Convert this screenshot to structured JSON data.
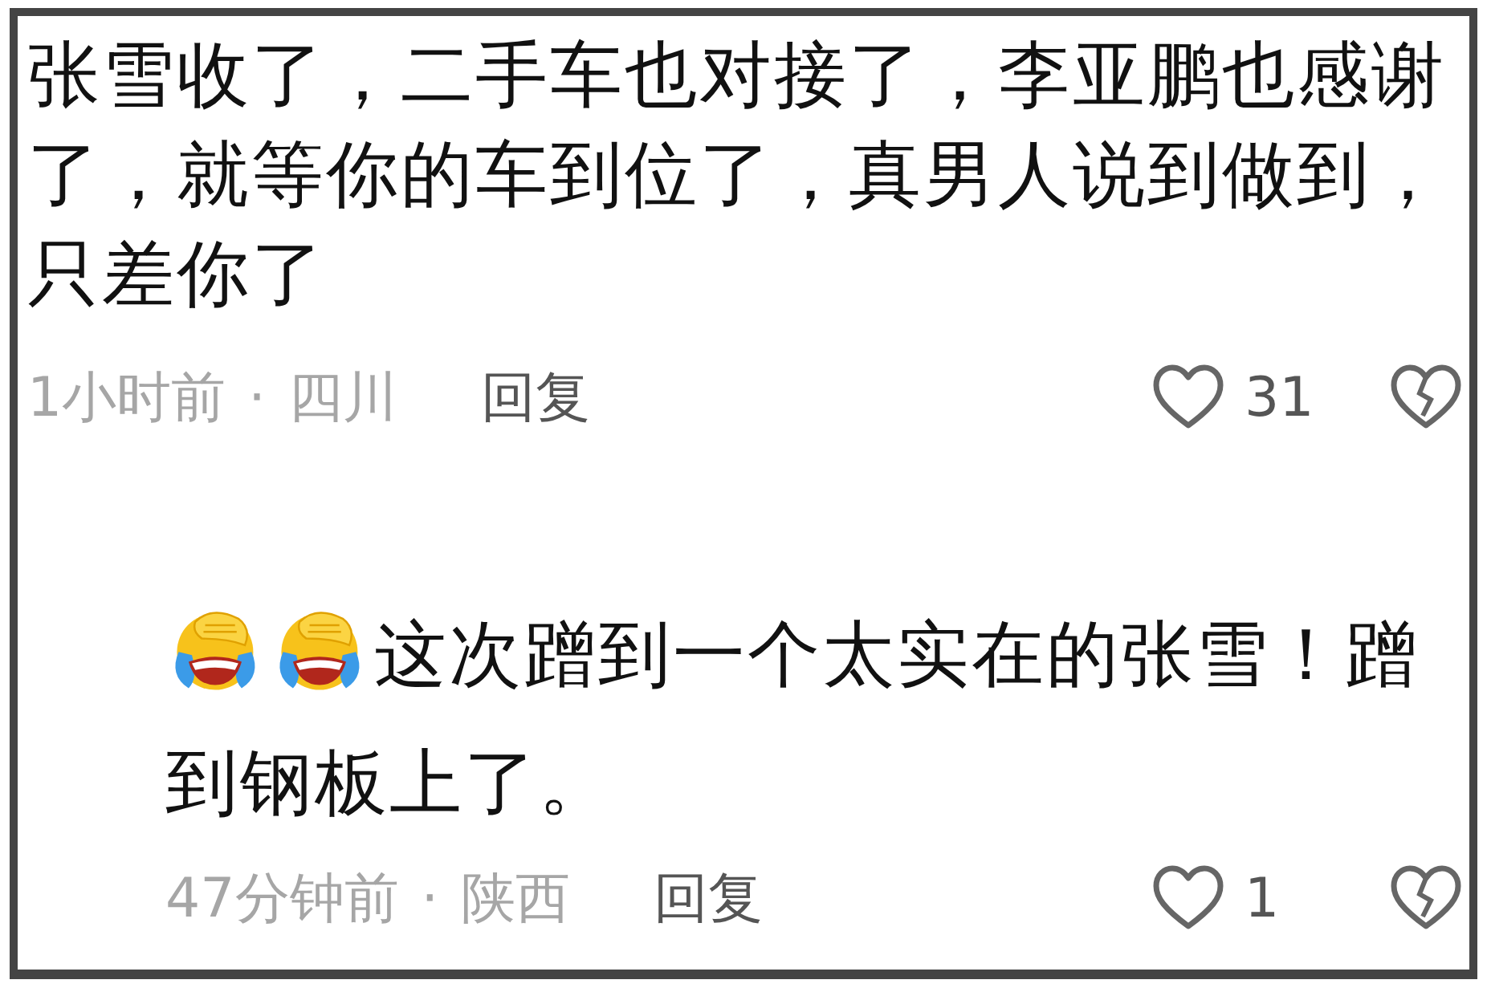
{
  "comments": [
    {
      "text": "张雪收了，二手车也对接了，李亚鹏也感谢了，就等你的车到位了，真男人说到做到，只差你了",
      "time": "1小时前",
      "separator": "·",
      "location": "四川",
      "reply_label": "回复",
      "likes": "31",
      "reply": false
    },
    {
      "text": "这次蹭到一个太实在的张雪！蹭到钢板上了。",
      "emoji": [
        {
          "kind": "facepalm-cry"
        },
        {
          "kind": "facepalm-cry"
        }
      ],
      "time": "47分钟前",
      "separator": "·",
      "location": "陕西",
      "reply_label": "回复",
      "likes": "1",
      "reply": true
    }
  ]
}
